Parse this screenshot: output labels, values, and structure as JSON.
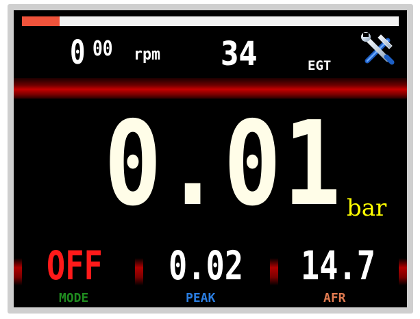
{
  "progress": {
    "fraction": 0.1,
    "fill_color": "#f0533b"
  },
  "header": {
    "rpm_value_big": "0",
    "rpm_value_small": "00",
    "rpm_unit": "rpm",
    "egt_value": "34",
    "egt_label": "EGT",
    "settings_icon": "wrench-hammer-icon"
  },
  "main": {
    "value": "0.01",
    "unit": "bar",
    "value_color": "#fffde8",
    "unit_color": "#ffff00"
  },
  "bottom": {
    "mode": {
      "value": "OFF",
      "label": "MODE",
      "value_color": "#ff1a1a",
      "label_color": "#1f8a1f"
    },
    "peak": {
      "value": "0.02",
      "label": "PEAK",
      "value_color": "#ffffff",
      "label_color": "#2a7de0"
    },
    "afr": {
      "value": "14.7",
      "label": "AFR",
      "value_color": "#ffffff",
      "label_color": "#e07a50"
    }
  }
}
